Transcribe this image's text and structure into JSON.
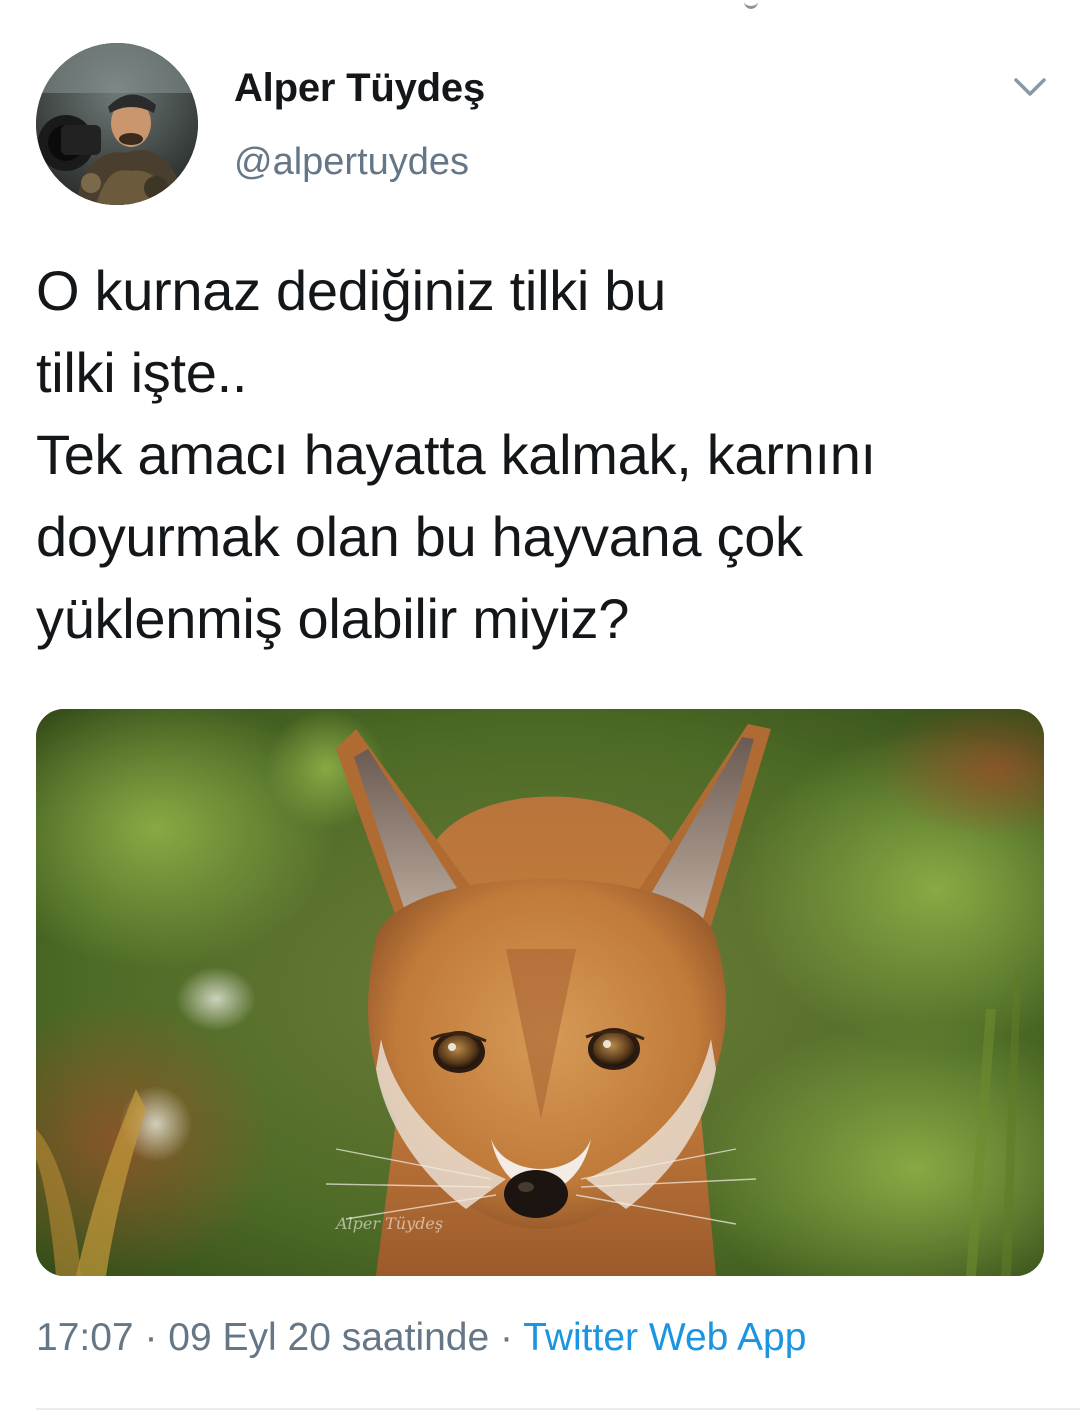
{
  "author": {
    "display_name": "Alper Tüydeş",
    "handle": "@alpertuydes"
  },
  "tweet": {
    "lines": [
      "O kurnaz dediğiniz tilki bu",
      "tilki işte..",
      "Tek amacı hayatta kalmak, karnını",
      "doyurmak olan bu hayvana çok",
      "yüklenmiş olabilir miyiz?"
    ]
  },
  "media": {
    "watermark": "Alper Tüydeş"
  },
  "meta": {
    "time": "17:07",
    "separator1": " · ",
    "date": "09 Eyl 20 saatinde",
    "separator2": " · ",
    "source": "Twitter Web App"
  },
  "icons": {
    "more": "chevron-down-icon"
  },
  "colors": {
    "text_primary": "#14171a",
    "text_secondary": "#657786",
    "link": "#1b95e0",
    "divider": "#e6ecf0"
  }
}
